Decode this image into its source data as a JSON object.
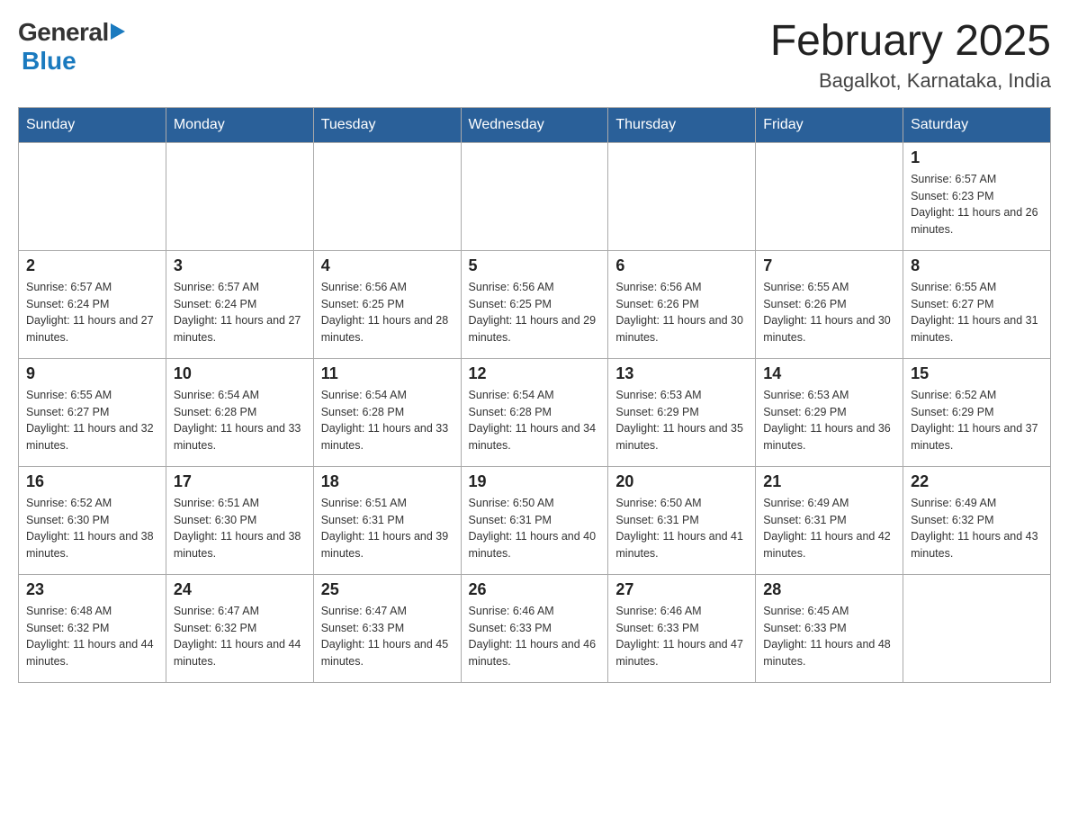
{
  "header": {
    "logo_general": "General",
    "logo_blue": "Blue",
    "month_title": "February 2025",
    "location": "Bagalkot, Karnataka, India"
  },
  "weekdays": [
    "Sunday",
    "Monday",
    "Tuesday",
    "Wednesday",
    "Thursday",
    "Friday",
    "Saturday"
  ],
  "weeks": [
    [
      {
        "day": "",
        "info": "",
        "empty": true
      },
      {
        "day": "",
        "info": "",
        "empty": true
      },
      {
        "day": "",
        "info": "",
        "empty": true
      },
      {
        "day": "",
        "info": "",
        "empty": true
      },
      {
        "day": "",
        "info": "",
        "empty": true
      },
      {
        "day": "",
        "info": "",
        "empty": true
      },
      {
        "day": "1",
        "info": "Sunrise: 6:57 AM\nSunset: 6:23 PM\nDaylight: 11 hours and 26 minutes.",
        "empty": false
      }
    ],
    [
      {
        "day": "2",
        "info": "Sunrise: 6:57 AM\nSunset: 6:24 PM\nDaylight: 11 hours and 27 minutes.",
        "empty": false
      },
      {
        "day": "3",
        "info": "Sunrise: 6:57 AM\nSunset: 6:24 PM\nDaylight: 11 hours and 27 minutes.",
        "empty": false
      },
      {
        "day": "4",
        "info": "Sunrise: 6:56 AM\nSunset: 6:25 PM\nDaylight: 11 hours and 28 minutes.",
        "empty": false
      },
      {
        "day": "5",
        "info": "Sunrise: 6:56 AM\nSunset: 6:25 PM\nDaylight: 11 hours and 29 minutes.",
        "empty": false
      },
      {
        "day": "6",
        "info": "Sunrise: 6:56 AM\nSunset: 6:26 PM\nDaylight: 11 hours and 30 minutes.",
        "empty": false
      },
      {
        "day": "7",
        "info": "Sunrise: 6:55 AM\nSunset: 6:26 PM\nDaylight: 11 hours and 30 minutes.",
        "empty": false
      },
      {
        "day": "8",
        "info": "Sunrise: 6:55 AM\nSunset: 6:27 PM\nDaylight: 11 hours and 31 minutes.",
        "empty": false
      }
    ],
    [
      {
        "day": "9",
        "info": "Sunrise: 6:55 AM\nSunset: 6:27 PM\nDaylight: 11 hours and 32 minutes.",
        "empty": false
      },
      {
        "day": "10",
        "info": "Sunrise: 6:54 AM\nSunset: 6:28 PM\nDaylight: 11 hours and 33 minutes.",
        "empty": false
      },
      {
        "day": "11",
        "info": "Sunrise: 6:54 AM\nSunset: 6:28 PM\nDaylight: 11 hours and 33 minutes.",
        "empty": false
      },
      {
        "day": "12",
        "info": "Sunrise: 6:54 AM\nSunset: 6:28 PM\nDaylight: 11 hours and 34 minutes.",
        "empty": false
      },
      {
        "day": "13",
        "info": "Sunrise: 6:53 AM\nSunset: 6:29 PM\nDaylight: 11 hours and 35 minutes.",
        "empty": false
      },
      {
        "day": "14",
        "info": "Sunrise: 6:53 AM\nSunset: 6:29 PM\nDaylight: 11 hours and 36 minutes.",
        "empty": false
      },
      {
        "day": "15",
        "info": "Sunrise: 6:52 AM\nSunset: 6:29 PM\nDaylight: 11 hours and 37 minutes.",
        "empty": false
      }
    ],
    [
      {
        "day": "16",
        "info": "Sunrise: 6:52 AM\nSunset: 6:30 PM\nDaylight: 11 hours and 38 minutes.",
        "empty": false
      },
      {
        "day": "17",
        "info": "Sunrise: 6:51 AM\nSunset: 6:30 PM\nDaylight: 11 hours and 38 minutes.",
        "empty": false
      },
      {
        "day": "18",
        "info": "Sunrise: 6:51 AM\nSunset: 6:31 PM\nDaylight: 11 hours and 39 minutes.",
        "empty": false
      },
      {
        "day": "19",
        "info": "Sunrise: 6:50 AM\nSunset: 6:31 PM\nDaylight: 11 hours and 40 minutes.",
        "empty": false
      },
      {
        "day": "20",
        "info": "Sunrise: 6:50 AM\nSunset: 6:31 PM\nDaylight: 11 hours and 41 minutes.",
        "empty": false
      },
      {
        "day": "21",
        "info": "Sunrise: 6:49 AM\nSunset: 6:31 PM\nDaylight: 11 hours and 42 minutes.",
        "empty": false
      },
      {
        "day": "22",
        "info": "Sunrise: 6:49 AM\nSunset: 6:32 PM\nDaylight: 11 hours and 43 minutes.",
        "empty": false
      }
    ],
    [
      {
        "day": "23",
        "info": "Sunrise: 6:48 AM\nSunset: 6:32 PM\nDaylight: 11 hours and 44 minutes.",
        "empty": false
      },
      {
        "day": "24",
        "info": "Sunrise: 6:47 AM\nSunset: 6:32 PM\nDaylight: 11 hours and 44 minutes.",
        "empty": false
      },
      {
        "day": "25",
        "info": "Sunrise: 6:47 AM\nSunset: 6:33 PM\nDaylight: 11 hours and 45 minutes.",
        "empty": false
      },
      {
        "day": "26",
        "info": "Sunrise: 6:46 AM\nSunset: 6:33 PM\nDaylight: 11 hours and 46 minutes.",
        "empty": false
      },
      {
        "day": "27",
        "info": "Sunrise: 6:46 AM\nSunset: 6:33 PM\nDaylight: 11 hours and 47 minutes.",
        "empty": false
      },
      {
        "day": "28",
        "info": "Sunrise: 6:45 AM\nSunset: 6:33 PM\nDaylight: 11 hours and 48 minutes.",
        "empty": false
      },
      {
        "day": "",
        "info": "",
        "empty": true
      }
    ]
  ]
}
